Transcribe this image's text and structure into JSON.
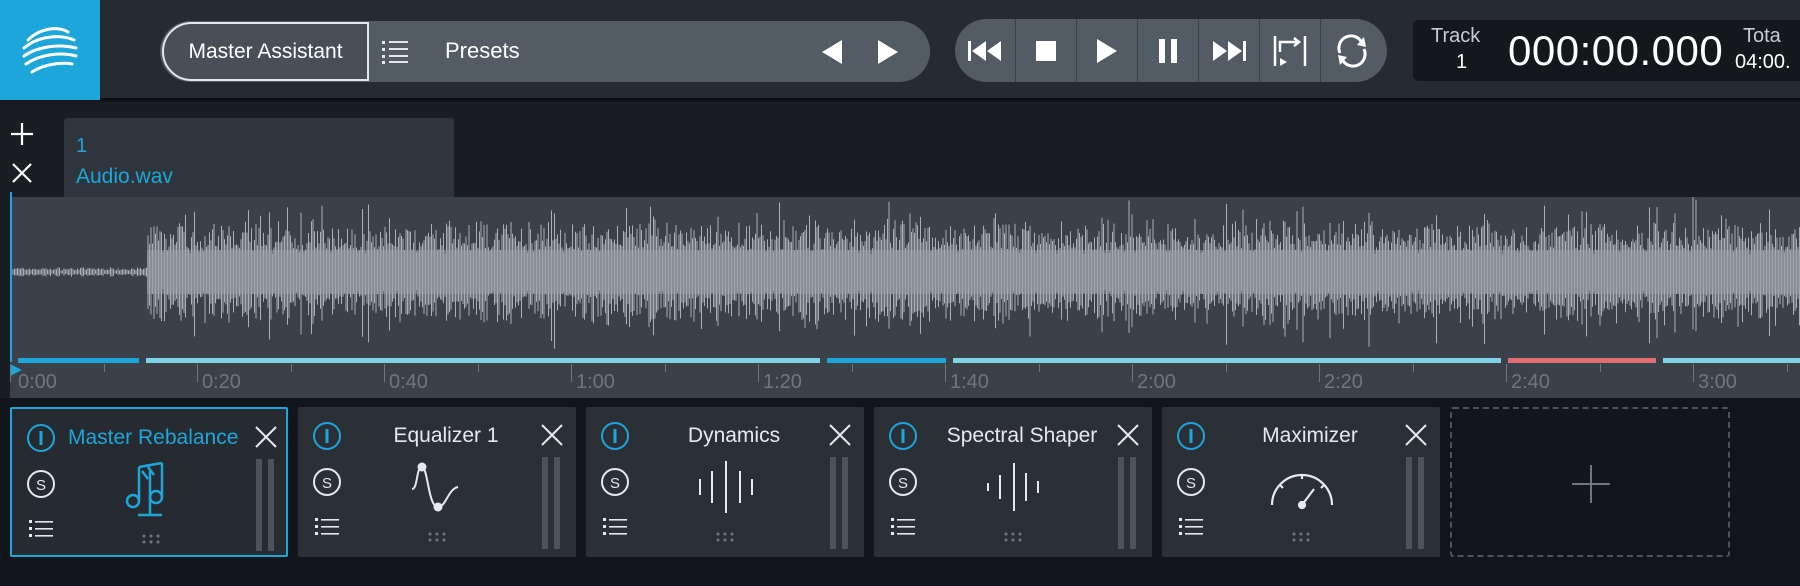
{
  "header": {
    "master_assistant_label": "Master Assistant",
    "presets_label": "Presets",
    "track_label": "Track",
    "track_number": "1",
    "time_display": "000:00.000",
    "total_label": "Tota",
    "total_value": "04:00.",
    "accent_color": "#1ca6d9"
  },
  "transport": {
    "buttons": [
      "skip-to-start-icon",
      "stop-icon",
      "play-icon",
      "pause-icon",
      "skip-to-end-icon",
      "loop-selection-icon",
      "loop-icon"
    ]
  },
  "track": {
    "tab_number": "1",
    "file_name": "Audio.wav"
  },
  "timeline": {
    "tick_labels": [
      "0:00",
      "0:20",
      "0:40",
      "1:00",
      "1:20",
      "1:40",
      "2:00",
      "2:20",
      "2:40",
      "3:00"
    ],
    "segment_colors": {
      "blue": "#1ca6d9",
      "light": "#7fd3e4",
      "red": "#e06c74"
    }
  },
  "modules": [
    {
      "name": "Master Rebalance",
      "active": true,
      "graphic": "music-note-icon"
    },
    {
      "name": "Equalizer 1",
      "active": false,
      "graphic": "eq-curve-icon"
    },
    {
      "name": "Dynamics",
      "active": false,
      "graphic": "dynamics-bars-icon"
    },
    {
      "name": "Spectral Shaper",
      "active": false,
      "graphic": "spectral-bars-icon"
    },
    {
      "name": "Maximizer",
      "active": false,
      "graphic": "gauge-icon"
    }
  ]
}
